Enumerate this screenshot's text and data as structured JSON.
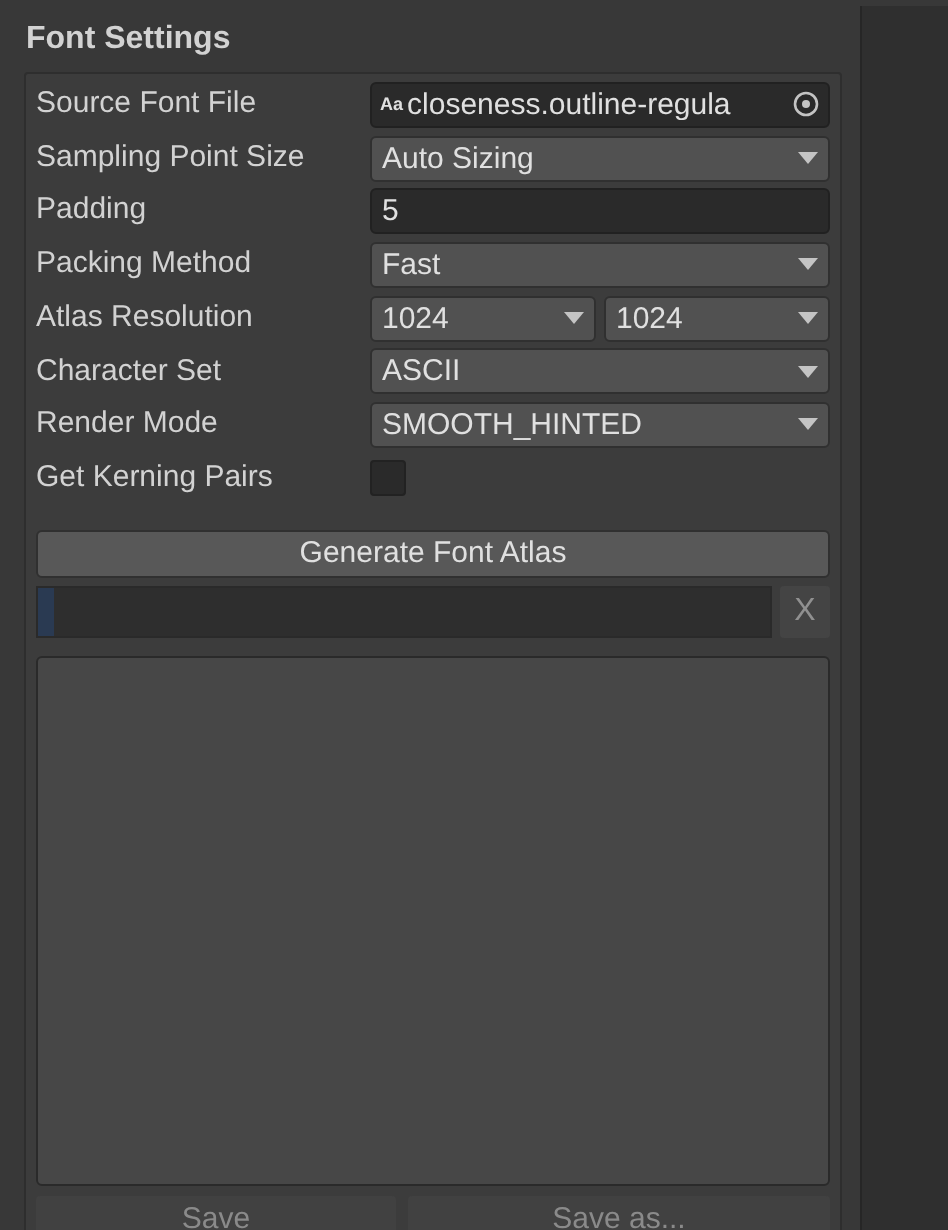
{
  "section_title": "Font Settings",
  "fields": [
    {
      "label": "Source Font File",
      "kind": "object",
      "value": "closeness.outline-regula",
      "icon": "Aa"
    },
    {
      "label": "Sampling Point Size",
      "kind": "dropdown",
      "value": "Auto Sizing"
    },
    {
      "label": "Padding",
      "kind": "text",
      "value": "5"
    },
    {
      "label": "Packing Method",
      "kind": "dropdown",
      "value": "Fast"
    },
    {
      "label": "Atlas Resolution",
      "kind": "pair",
      "values": [
        "1024",
        "1024"
      ]
    },
    {
      "label": "Character Set",
      "kind": "dropdown",
      "value": "ASCII"
    },
    {
      "label": "Render Mode",
      "kind": "dropdown",
      "value": "SMOOTH_HINTED"
    },
    {
      "label": "Get Kerning Pairs",
      "kind": "checkbox",
      "checked": false
    }
  ],
  "generate_button": "Generate Font Atlas",
  "progress": {
    "level": 0.01,
    "cancel": "X"
  },
  "footer_buttons": [
    {
      "label": "Save",
      "disabled": true
    },
    {
      "label": "Save as...",
      "disabled": true
    }
  ]
}
